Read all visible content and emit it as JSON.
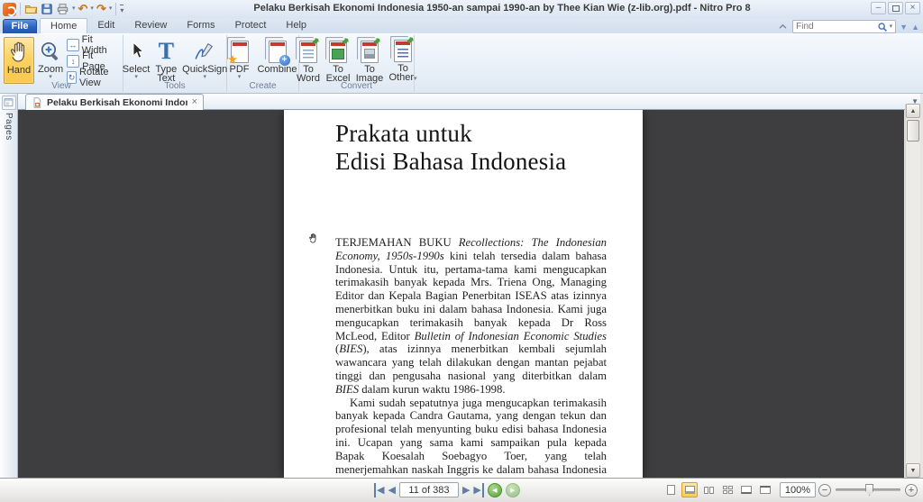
{
  "window": {
    "title": "Pelaku Berkisah Ekonomi Indonesia 1950-an sampai 1990-an by Thee Kian Wie (z-lib.org).pdf - Nitro Pro 8"
  },
  "glyphs": {
    "caret_down": "▾",
    "tab_list_arrow": "▼",
    "undo": "↶",
    "redo": "↷",
    "fit_width": "↔",
    "fit_page": "↕",
    "rotate": "↻",
    "find_next": "▼",
    "find_prev": "▲",
    "nav_first": "◀",
    "nav_prev": "◀",
    "nav_next": "▶",
    "nav_last": "▶",
    "history_back": "◀",
    "history_forward": "▶",
    "zoom_out": "−",
    "zoom_in": "+",
    "close_tab": "×",
    "win_min": "–",
    "win_close": "×",
    "scroll_up": "▲",
    "scroll_down": "▼",
    "plus": "+"
  },
  "menu_tabs": {
    "file": "File",
    "home": "Home",
    "edit": "Edit",
    "review": "Review",
    "forms": "Forms",
    "protect": "Protect",
    "help": "Help"
  },
  "find": {
    "placeholder": "Find"
  },
  "ribbon": {
    "view": {
      "label": "View",
      "hand": "Hand",
      "zoom": "Zoom",
      "fit_width": "Fit Width",
      "fit_page": "Fit Page",
      "rotate_view": "Rotate View"
    },
    "tools": {
      "label": "Tools",
      "select": "Select",
      "type_text": "Type Text",
      "quicksign": "QuickSign"
    },
    "create": {
      "label": "Create",
      "pdf": "PDF",
      "combine": "Combine"
    },
    "convert": {
      "label": "Convert",
      "to_word": "To Word",
      "to_excel": "To Excel",
      "to_image": "To Image",
      "to_other": "To Other"
    }
  },
  "document_tab": {
    "label": "Pelaku Berkisah Ekonomi Indonesia..."
  },
  "pages_panel": {
    "label": "Pages"
  },
  "page_content": {
    "heading_line1": "Prakata untuk",
    "heading_line2": "Edisi Bahasa Indonesia",
    "para1": {
      "r1": "TERJEMAHAN BUKU ",
      "r2": "Recollections: The Indonesian Economy, 1950s-1990s",
      "r3": " kini telah tersedia dalam bahasa Indonesia. Untuk itu, pertama-tama kami mengucapkan terimakasih banyak kepada Mrs. Triena Ong, Managing Editor dan Kepala Bagian Penerbitan ISEAS atas izinnya menerbitkan buku ini dalam bahasa Indonesia. Kami juga mengucapkan terimakasih banyak kepada Dr Ross McLeod, Editor ",
      "r4": "Bulletin of Indonesian Economic Studies",
      "r5": " (",
      "r6": "BIES",
      "r7": "), atas izinnya menerbitkan kembali sejumlah wawancara yang telah dilakukan dengan mantan pejabat tinggi dan pengusaha nasional yang diterbitkan dalam ",
      "r8": "BIES",
      "r9": " dalam kurun waktu 1986-1998."
    },
    "para2": "Kami sudah sepatutnya juga mengucapkan terimakasih banyak kepada Candra Gautama, yang dengan tekun dan profesional telah menyunting buku edisi bahasa Indonesia ini. Ucapan yang sama kami sampaikan pula kepada Bapak Koesalah Soebagyo Toer, yang telah menerjemahkan naskah Inggris ke dalam bahasa Indonesia dengan baik."
  },
  "status_bar": {
    "page_indicator": "11 of 383",
    "zoom_value": "100%"
  },
  "colors": {
    "accent_orange_highlight": "#fbd161",
    "file_button_blue": "#2d62c0",
    "canvas_dark": "#3e3e40",
    "nitro_brand_orange": "#ee6318"
  }
}
